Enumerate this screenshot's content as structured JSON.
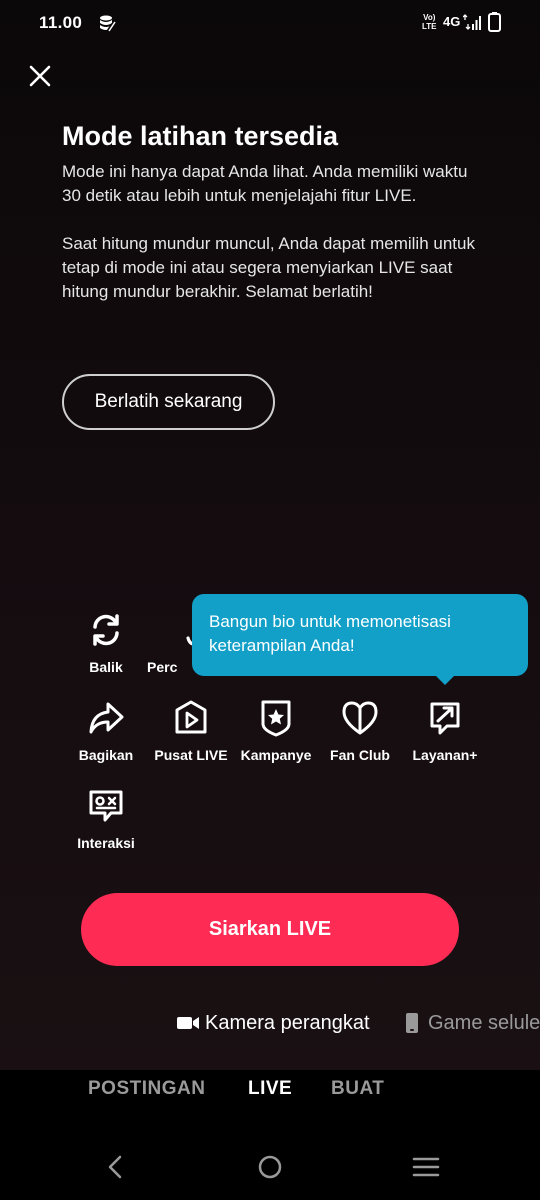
{
  "status_bar": {
    "time": "11.00",
    "volte_top": "Vo)",
    "volte_bottom": "LTE",
    "network": "4G"
  },
  "practice": {
    "title": "Mode latihan tersedia",
    "description": "Mode ini hanya dapat Anda lihat. Anda memiliki waktu 30 detik atau lebih untuk menjelajahi fitur LIVE.\n\nSaat hitung mundur muncul, Anda dapat memilih untuk tetap di mode ini atau segera menyiarkan LIVE saat hitung mundur berakhir. Selamat berlatih!",
    "button_label": "Berlatih sekarang"
  },
  "tools": {
    "flip": "Balik",
    "enhance": "Perc",
    "share": "Bagikan",
    "live_center": "Pusat LIVE",
    "campaign": "Kampanye",
    "fan_club": "Fan Club",
    "services": "Layanan+",
    "interaction": "Interaksi"
  },
  "tooltip": {
    "text": "Bangun bio untuk memonetisasi keterampilan Anda!"
  },
  "go_live": {
    "label": "Siarkan LIVE"
  },
  "sources": {
    "camera": "Kamera perangkat",
    "mobile_game": "Game selule"
  },
  "modes": {
    "post": "POSTINGAN",
    "live": "LIVE",
    "create": "BUAT",
    "active": "LIVE"
  },
  "colors": {
    "accent": "#fe2c55",
    "tooltip": "#12a0c9",
    "inactive_mode": "#9a9a9a"
  }
}
